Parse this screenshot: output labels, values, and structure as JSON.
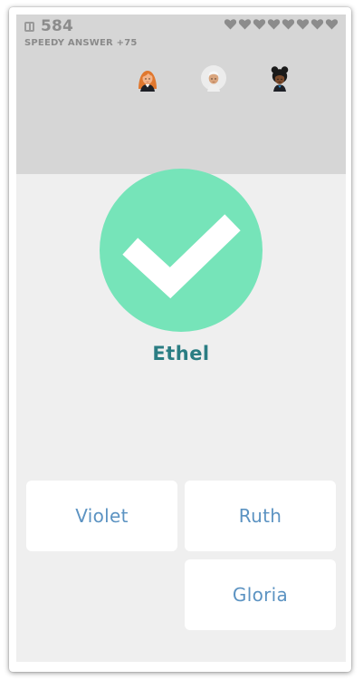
{
  "score": {
    "icon": "book-icon",
    "value": "584",
    "bonus_label": "SPEEDY ANSWER +75"
  },
  "lives": {
    "icon": "heart-icon",
    "count": 8,
    "color": "#8c8c8c"
  },
  "players": [
    {
      "icon": "player-avatar-orange-hair"
    },
    {
      "icon": "player-avatar-white-hair"
    },
    {
      "icon": "player-avatar-black-hair-buns"
    }
  ],
  "feedback": {
    "state": "correct",
    "icon": "checkmark-icon",
    "color": "#76e4b9",
    "answer": "Ethel"
  },
  "options": [
    {
      "label": "Violet"
    },
    {
      "label": "Ruth"
    },
    {
      "label": "Gloria"
    }
  ],
  "colors": {
    "top_panel": "#d6d6d6",
    "background": "#efefef",
    "answer_text": "#2a7d83",
    "option_text": "#5c93c2"
  }
}
